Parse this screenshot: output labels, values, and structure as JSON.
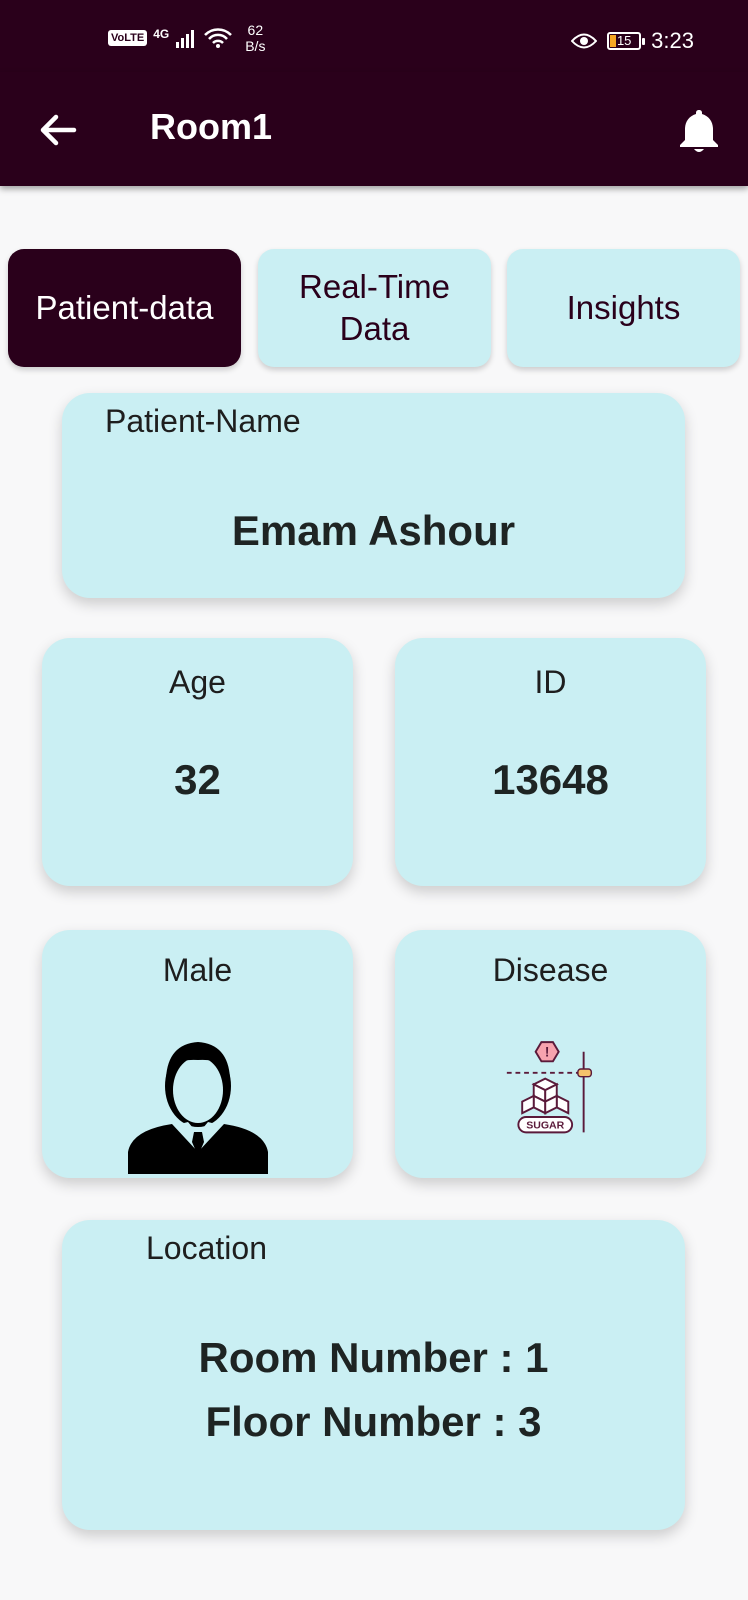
{
  "status_bar": {
    "volte": "VoLTE",
    "network": "4G",
    "speed_value": "62",
    "speed_unit": "B/s",
    "battery": "15",
    "time": "3:23"
  },
  "app_bar": {
    "title": "Room1",
    "back_icon": "arrow-left-icon",
    "notification_icon": "bell-icon"
  },
  "tabs": [
    {
      "label": "Patient-data",
      "active": true
    },
    {
      "label": "Real-Time Data",
      "active": false
    },
    {
      "label": "Insights",
      "active": false
    }
  ],
  "patient": {
    "name_label": "Patient-Name",
    "name": "Emam Ashour",
    "age_label": "Age",
    "age": "32",
    "id_label": "ID",
    "id": "13648",
    "gender": "Male",
    "gender_icon": "male-avatar-icon",
    "disease_label": "Disease",
    "disease_icon_text": "SUGAR",
    "disease_icon": "sugar-diabetes-icon",
    "location_label": "Location",
    "room_line": "Room Number : 1",
    "floor_line": "Floor Number : 3"
  },
  "colors": {
    "primary_dark": "#2a001b",
    "card_bg": "#caeff3",
    "page_bg": "#f8f8f9",
    "text_dark": "#1e2423"
  }
}
